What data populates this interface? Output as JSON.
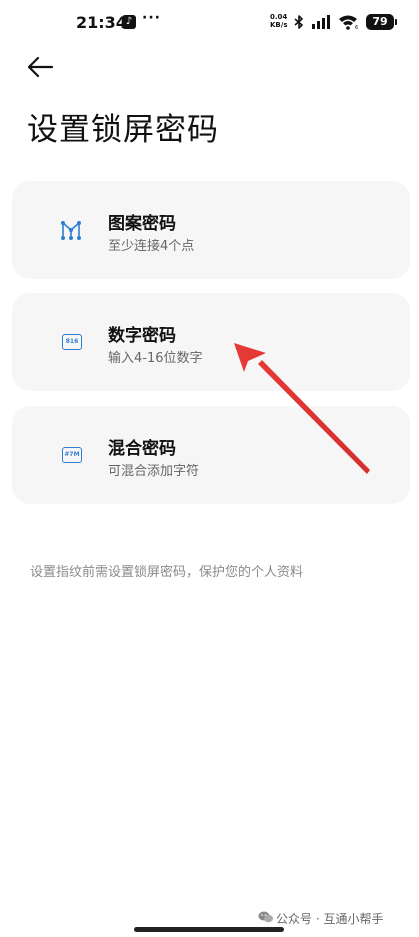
{
  "status_bar": {
    "time": "21:34",
    "app_icon_glyph": "♪",
    "more_dots": "···",
    "net_speed_value": "0.04",
    "net_speed_unit": "KB/s",
    "battery": "79"
  },
  "header": {
    "title": "设置锁屏密码"
  },
  "options": [
    {
      "title": "图案密码",
      "subtitle": "至少连接4个点",
      "icon": "pattern-lock-icon"
    },
    {
      "title": "数字密码",
      "subtitle": "输入4-16位数字",
      "icon": "numeric-pin-icon",
      "icon_text": "816"
    },
    {
      "title": "混合密码",
      "subtitle": "可混合添加字符",
      "icon": "mixed-password-icon",
      "icon_text": "#7M"
    }
  ],
  "hint": "设置指纹前需设置锁屏密码，保护您的个人资料",
  "watermark": "公众号 · 互通小帮手",
  "colors": {
    "accent": "#2f7fd1",
    "card_bg": "#f6f6f6",
    "arrow": "#e53935"
  }
}
